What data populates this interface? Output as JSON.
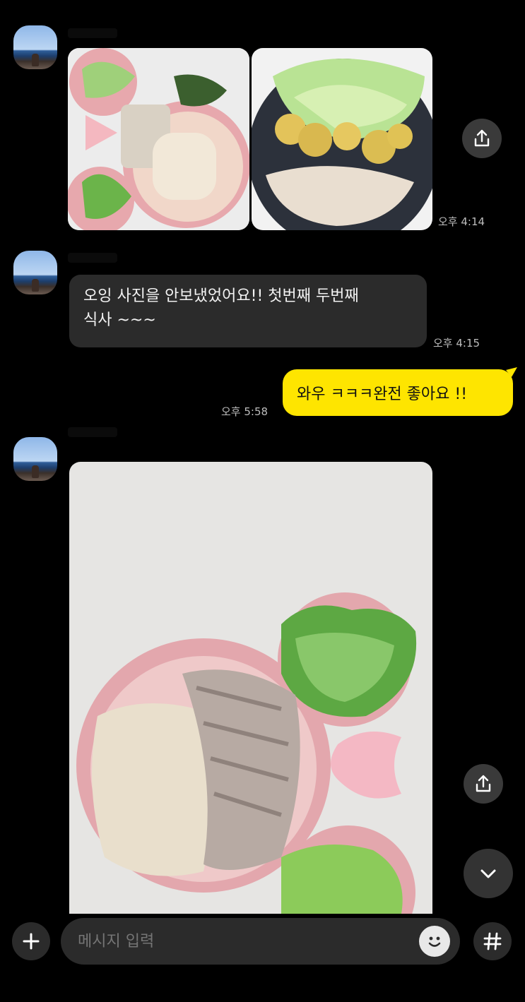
{
  "messages": {
    "photo_set_time": "오후 4:14",
    "text1_line1": "오잉 사진을 안보냈었어요!! 첫번째 두번째",
    "text1_line2": "식사 ~~~",
    "text1_time": "오후 4:15",
    "reply_text": "와우 ㅋㅋㅋ완전 좋아요 !!",
    "reply_time": "오후 5:58"
  },
  "input": {
    "placeholder": "메시지 입력"
  },
  "icons": {
    "add": "plus-icon",
    "share": "share-icon",
    "scroll_down": "chevron-down-icon",
    "emoji": "emoji-icon",
    "hashtag": "hashtag-icon"
  },
  "colors": {
    "background": "#000000",
    "my_bubble": "#fee500",
    "other_bubble": "#2b2b2b"
  }
}
